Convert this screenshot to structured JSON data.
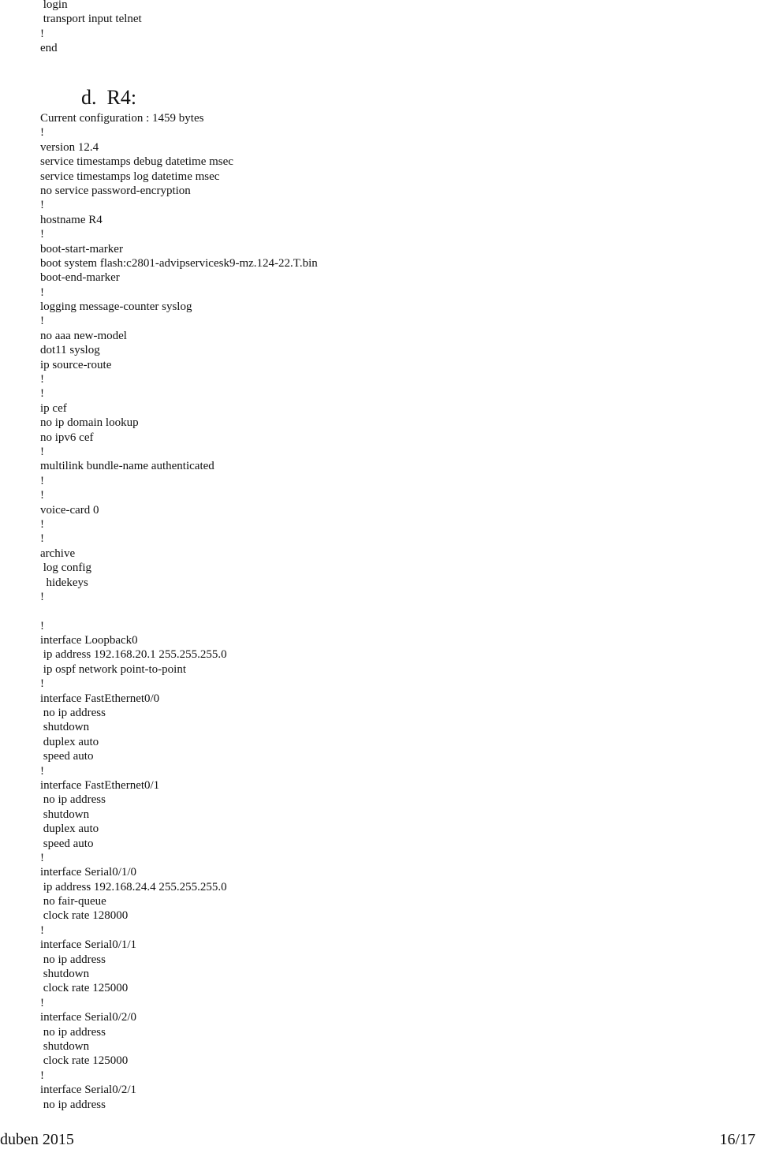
{
  "document": {
    "top_lines": [
      " login",
      " transport input telnet",
      "!",
      "end"
    ],
    "heading": "d.  R4:",
    "config_lines": [
      "Current configuration : 1459 bytes",
      "!",
      "version 12.4",
      "service timestamps debug datetime msec",
      "service timestamps log datetime msec",
      "no service password-encryption",
      "!",
      "hostname R4",
      "!",
      "boot-start-marker",
      "boot system flash:c2801-advipservicesk9-mz.124-22.T.bin",
      "boot-end-marker",
      "!",
      "logging message-counter syslog",
      "!",
      "no aaa new-model",
      "dot11 syslog",
      "ip source-route",
      "!",
      "!",
      "ip cef",
      "no ip domain lookup",
      "no ipv6 cef",
      "!",
      "multilink bundle-name authenticated",
      "!",
      "!",
      "voice-card 0",
      "!",
      "!",
      "archive",
      " log config",
      "  hidekeys",
      "!",
      "",
      "!",
      "interface Loopback0",
      " ip address 192.168.20.1 255.255.255.0",
      " ip ospf network point-to-point",
      "!",
      "interface FastEthernet0/0",
      " no ip address",
      " shutdown",
      " duplex auto",
      " speed auto",
      "!",
      "interface FastEthernet0/1",
      " no ip address",
      " shutdown",
      " duplex auto",
      " speed auto",
      "!",
      "interface Serial0/1/0",
      " ip address 192.168.24.4 255.255.255.0",
      " no fair-queue",
      " clock rate 128000",
      "!",
      "interface Serial0/1/1",
      " no ip address",
      " shutdown",
      " clock rate 125000",
      "!",
      "interface Serial0/2/0",
      " no ip address",
      " shutdown",
      " clock rate 125000",
      "!",
      "interface Serial0/2/1",
      " no ip address"
    ]
  },
  "footer": {
    "date": "duben 2015",
    "page": "16/17"
  }
}
